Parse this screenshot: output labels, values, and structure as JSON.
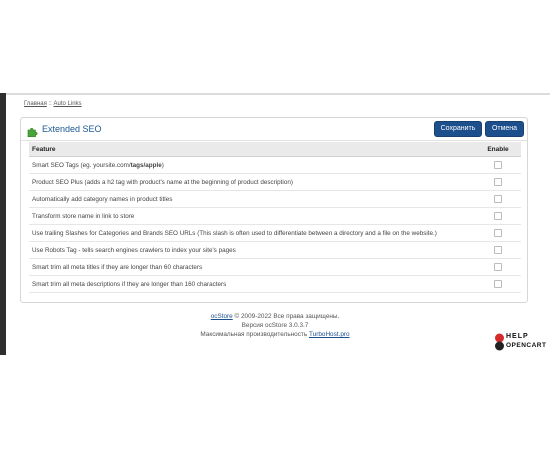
{
  "breadcrumb": {
    "home": "Главная",
    "sep": "::",
    "current": "Auto Links"
  },
  "panel": {
    "title": "Extended SEO",
    "save_label": "Сохранить",
    "cancel_label": "Отмена",
    "accent_color": "#1c4f8c"
  },
  "table": {
    "headers": {
      "feature": "Feature",
      "enable": "Enable"
    },
    "rows": [
      {
        "parts": [
          "Smart SEO Tags (eg. yoursite.com/",
          "tags/apple",
          ")"
        ],
        "enabled": false
      },
      {
        "label": "Product SEO Plus (adds a h2 tag with product's name at the beginning of product description)",
        "enabled": false
      },
      {
        "label": "Automatically add category names in product titles",
        "enabled": false
      },
      {
        "label": "Transform store name in link to store",
        "enabled": false
      },
      {
        "label": "Use trailing Slashes for Categories and Brands SEO URLs (This slash is often used to differentiate between a directory and a file on the website.)",
        "enabled": false
      },
      {
        "label": "Use Robots Tag - tells search engines crawlers to index your site's pages",
        "enabled": false
      },
      {
        "label": "Smart trim all meta titles if they are longer than 60 characters",
        "enabled": false
      },
      {
        "label": "Smart trim all meta descriptions if they are longer than 160 characters",
        "enabled": false
      }
    ]
  },
  "footer": {
    "brand": "ocStore",
    "copyright": "© 2009-2022 Все права защищены.",
    "version": "Версия ocStore 3.0.3.7",
    "perf_prefix": "Максимальная производительность",
    "host": "TurboHost.pro"
  },
  "logo": {
    "line1": "HELP",
    "line2": "OPENCART"
  }
}
